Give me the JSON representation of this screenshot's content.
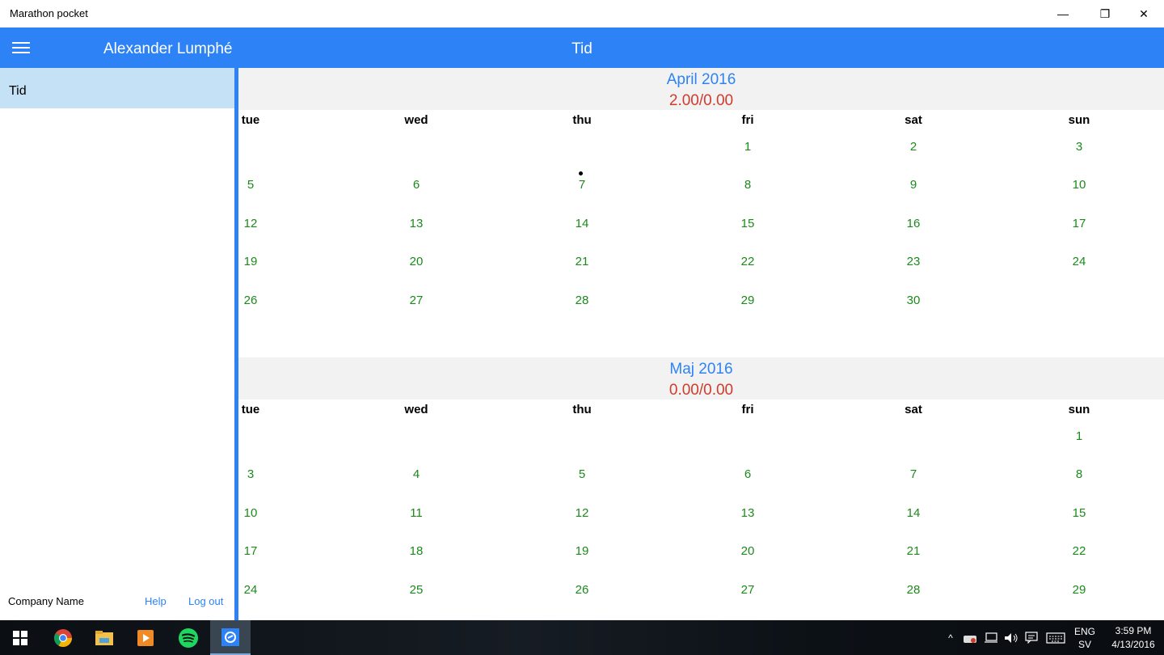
{
  "window": {
    "title": "Marathon pocket",
    "controls": {
      "minimize": "—",
      "restore": "❐",
      "close": "✕"
    }
  },
  "appbar": {
    "user_name": "Alexander Lumphé",
    "page_title": "Tid"
  },
  "sidebar": {
    "items": [
      {
        "label": "Tid",
        "selected": true
      }
    ],
    "footer": {
      "company": "Company Name",
      "help": "Help",
      "logout": "Log out"
    }
  },
  "calendar": {
    "weekdays": [
      "tue",
      "wed",
      "thu",
      "fri",
      "sat",
      "sun"
    ],
    "months": [
      {
        "name": "April 2016",
        "hours": "2.00/0.00",
        "weeks": [
          [
            "",
            "",
            "",
            "1",
            "2",
            "3"
          ],
          [
            "5",
            "6",
            "7",
            "8",
            "9",
            "10"
          ],
          [
            "12",
            "13",
            "14",
            "15",
            "16",
            "17"
          ],
          [
            "19",
            "20",
            "21",
            "22",
            "23",
            "24"
          ],
          [
            "26",
            "27",
            "28",
            "29",
            "30",
            ""
          ]
        ],
        "marked_day": "7"
      },
      {
        "name": "Maj 2016",
        "hours": "0.00/0.00",
        "weeks": [
          [
            "",
            "",
            "",
            "",
            "",
            "1"
          ],
          [
            "3",
            "4",
            "5",
            "6",
            "7",
            "8"
          ],
          [
            "10",
            "11",
            "12",
            "13",
            "14",
            "15"
          ],
          [
            "17",
            "18",
            "19",
            "20",
            "21",
            "22"
          ],
          [
            "24",
            "25",
            "26",
            "27",
            "28",
            "29"
          ]
        ],
        "marked_day": ""
      }
    ]
  },
  "taskbar": {
    "apps": [
      "windows-start-icon",
      "chrome-icon",
      "file-explorer-icon",
      "media-player-icon",
      "spotify-icon",
      "marathon-pocket-icon"
    ],
    "tray": {
      "language": "ENG",
      "layout": "SV",
      "time": "3:59 PM",
      "date": "4/13/2016"
    }
  },
  "colors": {
    "accent": "#2d83f5",
    "nav_selected": "#c5e1f5",
    "month_name": "#2d83f5",
    "hours": "#d13b2b",
    "day_number": "#1b8a1b",
    "link": "#2d83f5",
    "divider": "#2d83f5"
  }
}
